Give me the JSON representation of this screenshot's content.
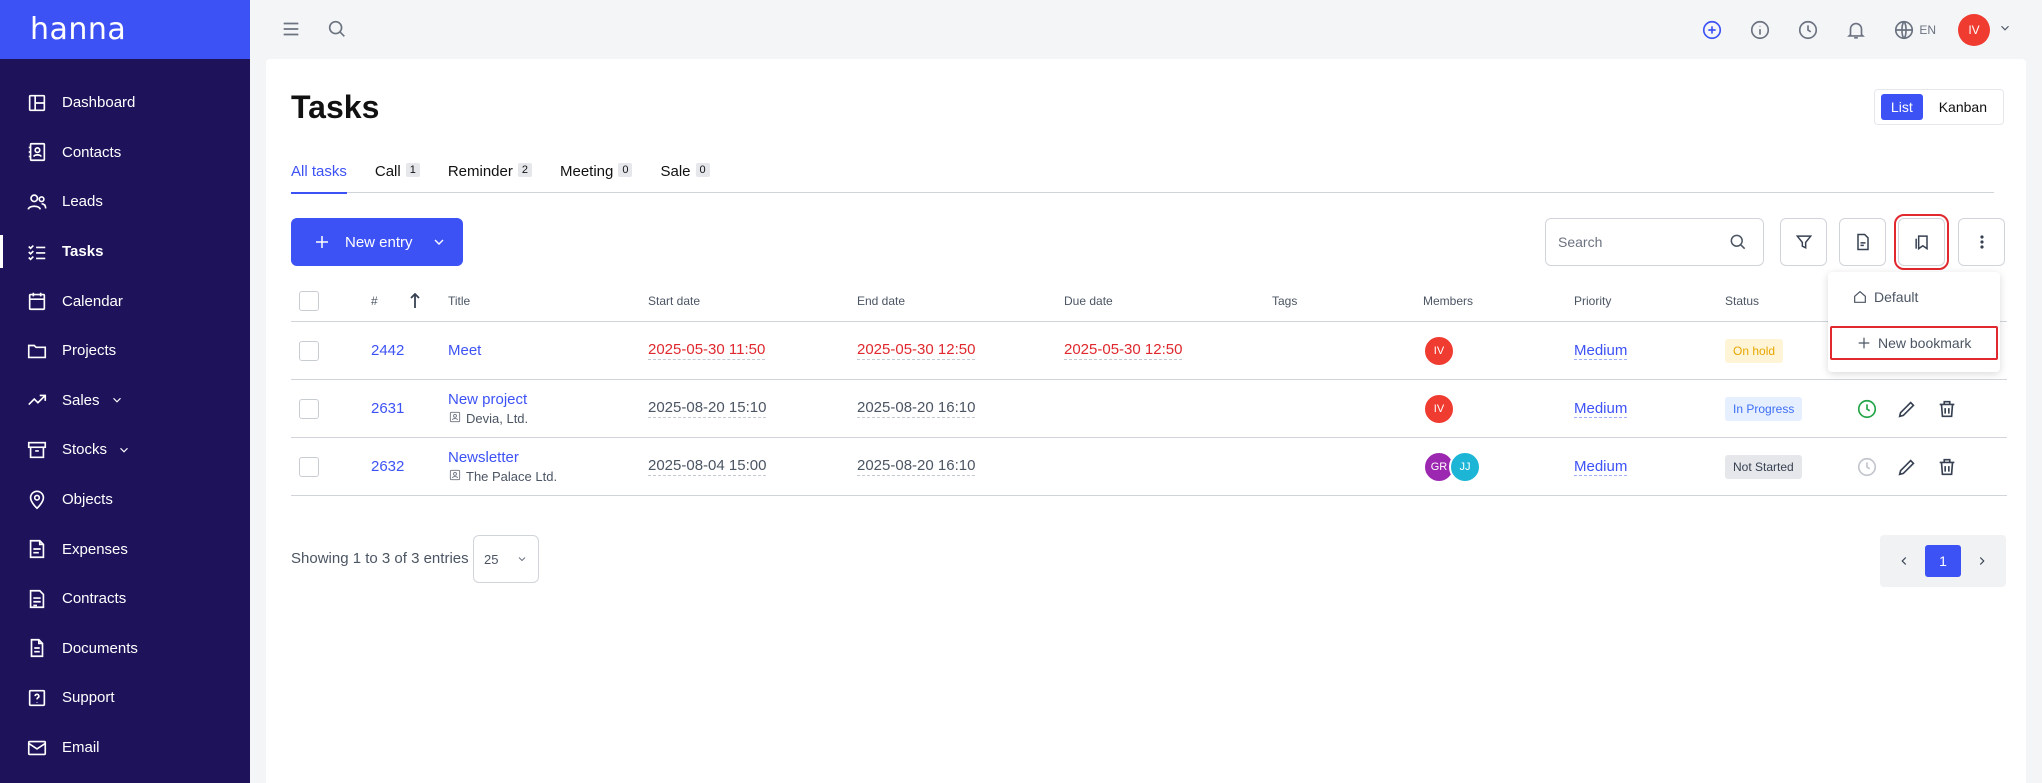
{
  "app": {
    "logo": "hanna"
  },
  "sidebar": {
    "items": [
      {
        "label": "Dashboard",
        "icon": "dashboard-icon",
        "active": false,
        "expandable": false
      },
      {
        "label": "Contacts",
        "icon": "contacts-icon",
        "active": false,
        "expandable": false
      },
      {
        "label": "Leads",
        "icon": "leads-icon",
        "active": false,
        "expandable": false
      },
      {
        "label": "Tasks",
        "icon": "tasks-icon",
        "active": true,
        "expandable": false
      },
      {
        "label": "Calendar",
        "icon": "calendar-icon",
        "active": false,
        "expandable": false
      },
      {
        "label": "Projects",
        "icon": "folder-icon",
        "active": false,
        "expandable": false
      },
      {
        "label": "Sales",
        "icon": "trending-up-icon",
        "active": false,
        "expandable": true
      },
      {
        "label": "Stocks",
        "icon": "archive-icon",
        "active": false,
        "expandable": true
      },
      {
        "label": "Objects",
        "icon": "map-pin-icon",
        "active": false,
        "expandable": false
      },
      {
        "label": "Expenses",
        "icon": "receipt-icon",
        "active": false,
        "expandable": false
      },
      {
        "label": "Contracts",
        "icon": "contract-icon",
        "active": false,
        "expandable": false
      },
      {
        "label": "Documents",
        "icon": "document-icon",
        "active": false,
        "expandable": false
      },
      {
        "label": "Support",
        "icon": "help-icon",
        "active": false,
        "expandable": false
      },
      {
        "label": "Email",
        "icon": "mail-icon",
        "active": false,
        "expandable": false
      }
    ]
  },
  "topbar": {
    "language": "EN",
    "user_initials": "IV"
  },
  "page": {
    "title": "Tasks",
    "views": [
      "List",
      "Kanban"
    ],
    "active_view": "List"
  },
  "tabs": [
    {
      "label": "All tasks",
      "count": null,
      "active": true
    },
    {
      "label": "Call",
      "count": "1",
      "active": false
    },
    {
      "label": "Reminder",
      "count": "2",
      "active": false
    },
    {
      "label": "Meeting",
      "count": "0",
      "active": false
    },
    {
      "label": "Sale",
      "count": "0",
      "active": false
    }
  ],
  "toolbar": {
    "new_entry_label": "New entry",
    "search_placeholder": "Search"
  },
  "bookmark_menu": {
    "default_label": "Default",
    "new_bookmark_label": "New bookmark"
  },
  "table": {
    "columns": {
      "id": "#",
      "title": "Title",
      "start": "Start date",
      "end": "End date",
      "due": "Due date",
      "tags": "Tags",
      "members": "Members",
      "priority": "Priority",
      "status": "Status"
    },
    "rows": [
      {
        "id": "2442",
        "title": "Meet",
        "company": "",
        "start": "2025-05-30 11:50",
        "end": "2025-05-30 12:50",
        "due": "2025-05-30 12:50",
        "overdue": true,
        "members": [
          {
            "initials": "IV",
            "color": "#ef3b30"
          }
        ],
        "priority": "Medium",
        "status": "On hold",
        "status_bg": "#fff4d6",
        "status_fg": "#e7a700",
        "show_actions": false,
        "clock_color": "#22a447"
      },
      {
        "id": "2631",
        "title": "New project",
        "company": "Devia, Ltd.",
        "start": "2025-08-20 15:10",
        "end": "2025-08-20 16:10",
        "due": "",
        "overdue": false,
        "members": [
          {
            "initials": "IV",
            "color": "#ef3b30"
          }
        ],
        "priority": "Medium",
        "status": "In Progress",
        "status_bg": "#e6efff",
        "status_fg": "#3d6ff5",
        "show_actions": true,
        "clock_color": "#22a447"
      },
      {
        "id": "2632",
        "title": "Newsletter",
        "company": "The Palace Ltd.",
        "start": "2025-08-04 15:00",
        "end": "2025-08-20 16:10",
        "due": "",
        "overdue": false,
        "members": [
          {
            "initials": "GR",
            "color": "#9c27b0"
          },
          {
            "initials": "JJ",
            "color": "#1cb5d6"
          }
        ],
        "priority": "Medium",
        "status": "Not Started",
        "status_bg": "#e5e7eb",
        "status_fg": "#374151",
        "show_actions": true,
        "clock_color": "#c2c6cc"
      }
    ]
  },
  "footer": {
    "summary": "Showing 1 to 3 of 3 entries",
    "page_size": "25",
    "current_page": "1"
  },
  "colors": {
    "accent": "#3d52f5",
    "sidebar_bg": "#1e135a",
    "highlight": "#e0282e"
  }
}
